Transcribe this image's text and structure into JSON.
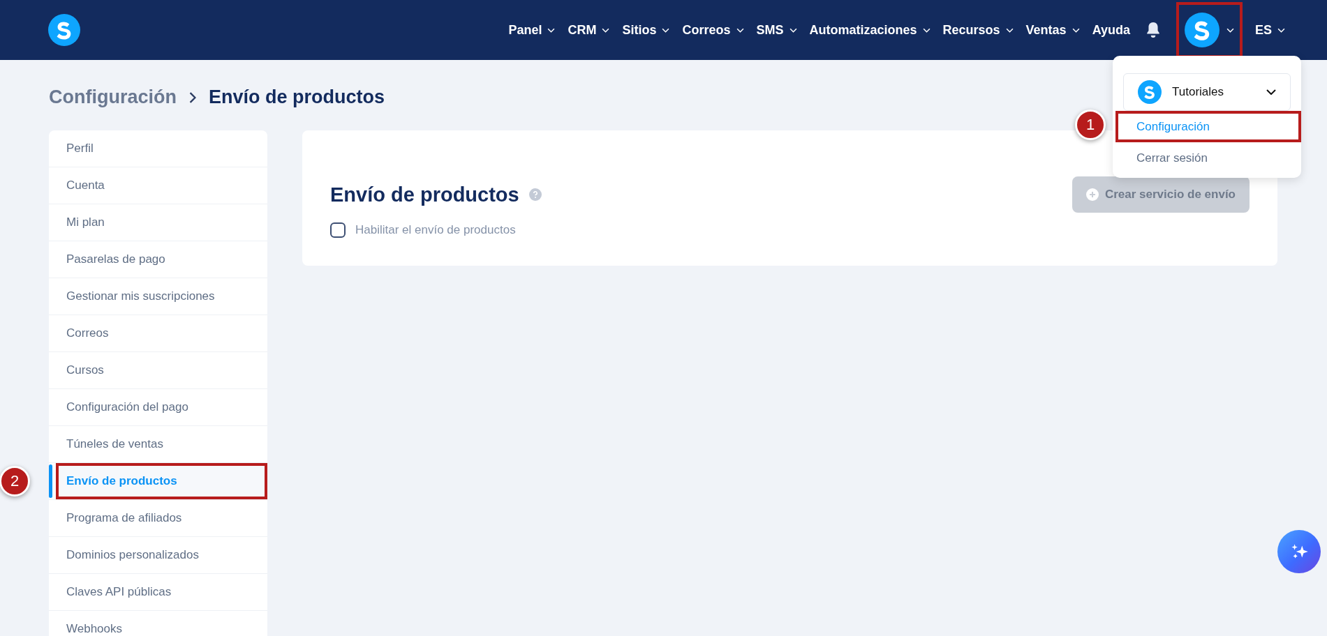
{
  "topbar": {
    "nav": [
      {
        "label": "Panel",
        "kind": "menu"
      },
      {
        "label": "CRM",
        "kind": "menu"
      },
      {
        "label": "Sitios",
        "kind": "menu"
      },
      {
        "label": "Correos",
        "kind": "menu"
      },
      {
        "label": "SMS",
        "kind": "menu"
      },
      {
        "label": "Automatizaciones",
        "kind": "menu"
      },
      {
        "label": "Recursos",
        "kind": "menu"
      },
      {
        "label": "Ventas",
        "kind": "menu"
      },
      {
        "label": "Ayuda",
        "kind": "link"
      }
    ],
    "account_menu": {
      "expanded": true,
      "highlighted": true
    },
    "language": "ES"
  },
  "breadcrumb": {
    "parent": "Configuración",
    "current": "Envío de productos"
  },
  "sidebar": {
    "items": [
      {
        "label": "Perfil",
        "selected": false,
        "highlighted": false
      },
      {
        "label": "Cuenta",
        "selected": false,
        "highlighted": false
      },
      {
        "label": "Mi plan",
        "selected": false,
        "highlighted": false
      },
      {
        "label": "Pasarelas de pago",
        "selected": false,
        "highlighted": false
      },
      {
        "label": "Gestionar mis suscripciones",
        "selected": false,
        "highlighted": false
      },
      {
        "label": "Correos",
        "selected": false,
        "highlighted": false
      },
      {
        "label": "Cursos",
        "selected": false,
        "highlighted": false
      },
      {
        "label": "Configuración del pago",
        "selected": false,
        "highlighted": false
      },
      {
        "label": "Túneles de ventas",
        "selected": false,
        "highlighted": false
      },
      {
        "label": "Envío de productos",
        "selected": true,
        "highlighted": true,
        "step": "2"
      },
      {
        "label": "Programa de afiliados",
        "selected": false,
        "highlighted": false
      },
      {
        "label": "Dominios personalizados",
        "selected": false,
        "highlighted": false
      },
      {
        "label": "Claves API públicas",
        "selected": false,
        "highlighted": false
      },
      {
        "label": "Webhooks",
        "selected": false,
        "highlighted": false
      }
    ]
  },
  "card": {
    "title": "Envío de productos",
    "checkbox": {
      "label": "Habilitar el envío de productos",
      "checked": false
    },
    "button": {
      "label": "Crear servicio de envío",
      "disabled": true
    }
  },
  "dropdown": {
    "account": "Tutoriales",
    "items": [
      {
        "label": "Configuración",
        "highlighted": true,
        "step": "1"
      },
      {
        "label": "Cerrar sesión",
        "highlighted": false
      }
    ]
  }
}
